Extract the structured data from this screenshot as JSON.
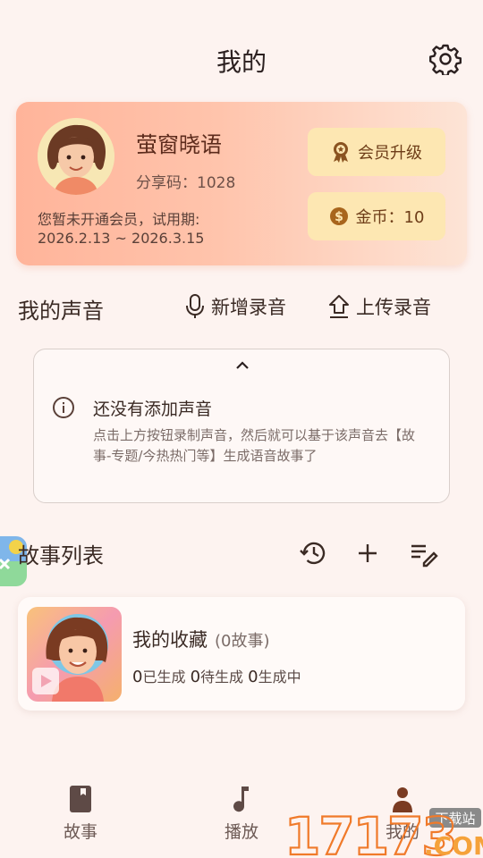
{
  "header": {
    "title": "我的"
  },
  "profile": {
    "username": "萤窗晓语",
    "share_code": "分享码：1028",
    "trial_line1": "您暂未开通会员，试用期:",
    "trial_line2": "2026.2.13 ~ 2026.3.15",
    "vip_label": "会员升级",
    "coin_label": "金币：10"
  },
  "voice": {
    "title": "我的声音",
    "add_label": "新增录音",
    "upload_label": "上传录音",
    "empty_title": "还没有添加声音",
    "empty_desc": "点击上方按钮录制声音，然后就可以基于该声音去【故事-专题/今热热门等】生成语音故事了"
  },
  "stories": {
    "title": "故事列表",
    "items": [
      {
        "name": "我的收藏",
        "count": "(0故事)",
        "generated_num": "0",
        "generated_label": "已生成",
        "pending_num": "0",
        "pending_label": "待生成",
        "generating_num": "0",
        "generating_label": "生成中"
      }
    ]
  },
  "tabs": [
    {
      "label": "故事",
      "icon": "book-icon"
    },
    {
      "label": "播放",
      "icon": "music-note-icon"
    },
    {
      "label": "我的",
      "icon": "person-icon"
    }
  ],
  "watermark": {
    "text": "17173",
    "badge": "下载站",
    "suffix": ".COM"
  },
  "colors": {
    "accent": "#ffb49a",
    "gold_button": "#fde7b2",
    "text_dark": "#3a2a24",
    "background": "#fdf3f0"
  }
}
